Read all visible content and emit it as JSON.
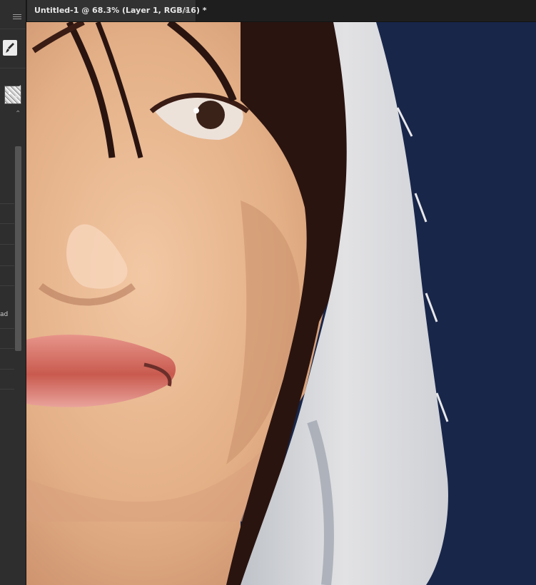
{
  "document_tab": {
    "title": "Untitled-1 @ 68.3% (Layer 1, RGB/16) *",
    "close_glyph": "×"
  },
  "left_panel": {
    "menu_icon": "hamburger-menu-icon",
    "brush_tool_icon": "brush-icon",
    "preset_icon": "brush-preset-thumbnail",
    "collapse_glyph": "⌃",
    "truncated_label": "ad"
  },
  "canvas": {
    "background_color": "#18264a",
    "skin_color": "#e8b893",
    "hair_color": "#2a1410",
    "veil_color": "#d9d9db",
    "lip_color": "#d97a72"
  }
}
